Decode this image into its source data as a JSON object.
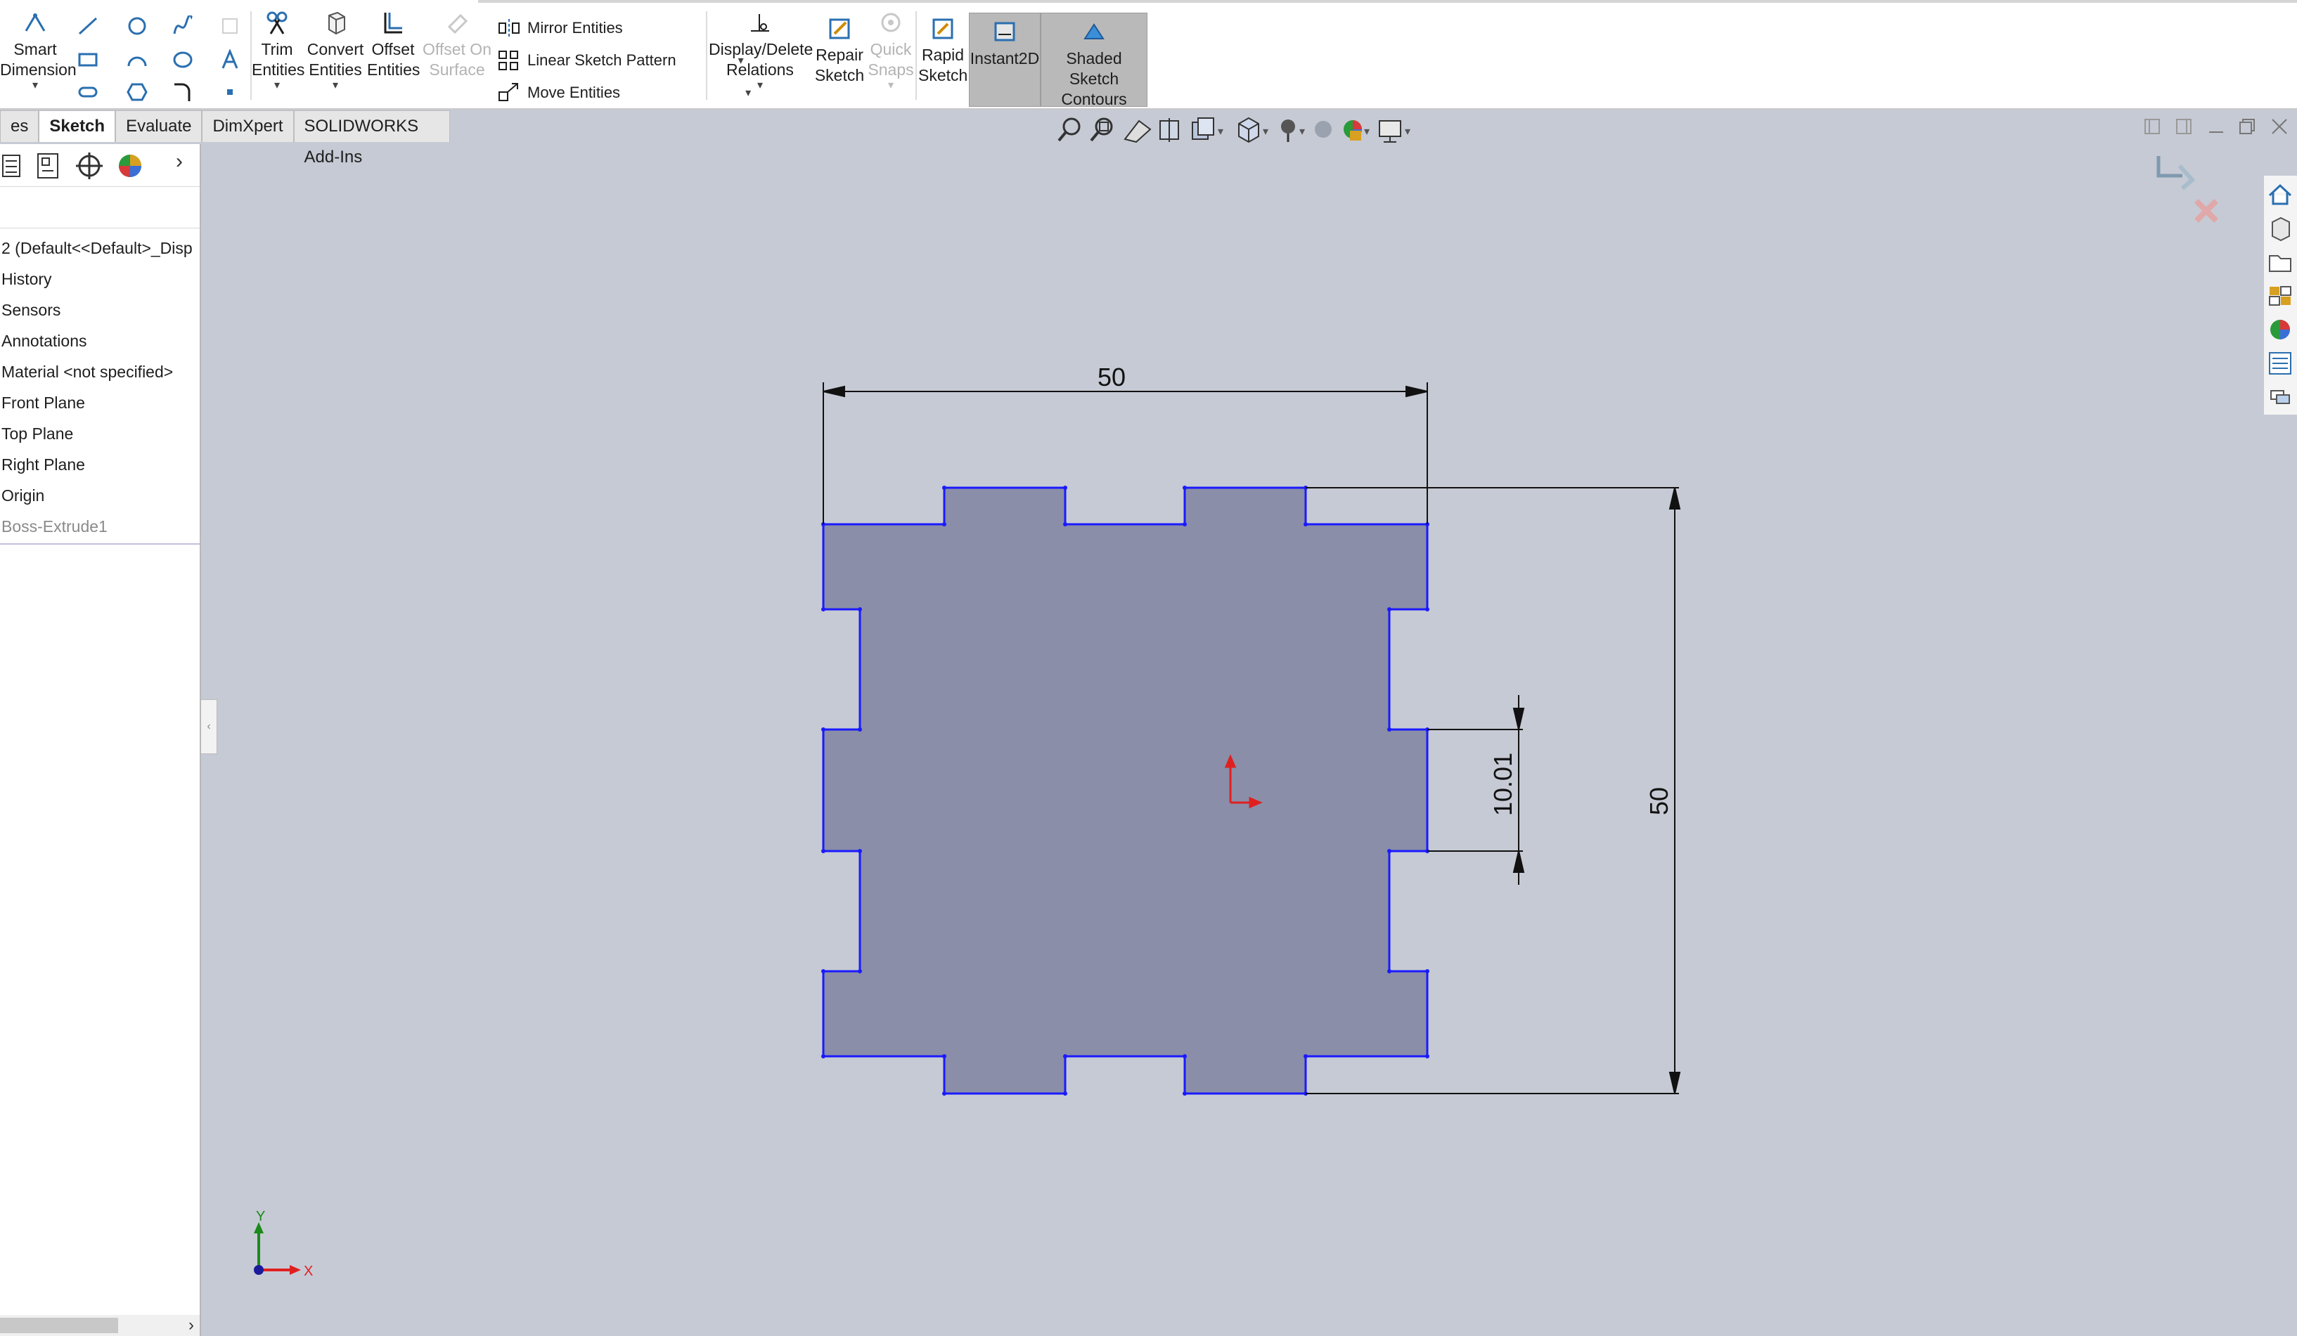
{
  "toolbar": {
    "smart_dimension": [
      "Smart",
      "Dimension"
    ],
    "trim_entities": [
      "Trim",
      "Entities"
    ],
    "convert_entities": [
      "Convert",
      "Entities"
    ],
    "offset_entities": [
      "Offset",
      "Entities"
    ],
    "offset_on_surface": [
      "Offset On",
      "Surface"
    ],
    "mirror_entities": "Mirror Entities",
    "linear_sketch_pattern": "Linear Sketch Pattern",
    "move_entities": "Move Entities",
    "display_delete_relations": [
      "Display/Delete",
      "Relations"
    ],
    "repair_sketch": [
      "Repair",
      "Sketch"
    ],
    "quick_snaps": [
      "Quick",
      "Snaps"
    ],
    "rapid_sketch": [
      "Rapid",
      "Sketch"
    ],
    "instant2d": "Instant2D",
    "shaded_sketch_contours": [
      "Shaded Sketch",
      "Contours"
    ]
  },
  "tabs": [
    {
      "label": "es",
      "active": false
    },
    {
      "label": "Sketch",
      "active": true
    },
    {
      "label": "Evaluate",
      "active": false
    },
    {
      "label": "DimXpert",
      "active": false
    },
    {
      "label": "SOLIDWORKS Add-Ins",
      "active": false
    }
  ],
  "tree": {
    "part_name": "2  (Default<<Default>_Disp",
    "items": [
      {
        "label": "History",
        "greyed": false
      },
      {
        "label": "Sensors",
        "greyed": false
      },
      {
        "label": "Annotations",
        "greyed": false
      },
      {
        "label": "Material <not specified>",
        "greyed": false
      },
      {
        "label": "Front Plane",
        "greyed": false
      },
      {
        "label": "Top Plane",
        "greyed": false
      },
      {
        "label": "Right Plane",
        "greyed": false
      },
      {
        "label": "Origin",
        "greyed": false
      },
      {
        "label": "Boss-Extrude1",
        "greyed": true
      }
    ]
  },
  "sketch": {
    "dim_width": "50",
    "dim_height": "50",
    "dim_tab": "10.01",
    "axis_x": "X",
    "axis_y": "Y"
  },
  "colors": {
    "sketch_fill": "#8a8ea8",
    "sketch_line": "#1a1aff",
    "viewport_bg": "#c6cad4",
    "origin_red": "#e02020",
    "axis_green": "#1a8a1a"
  }
}
